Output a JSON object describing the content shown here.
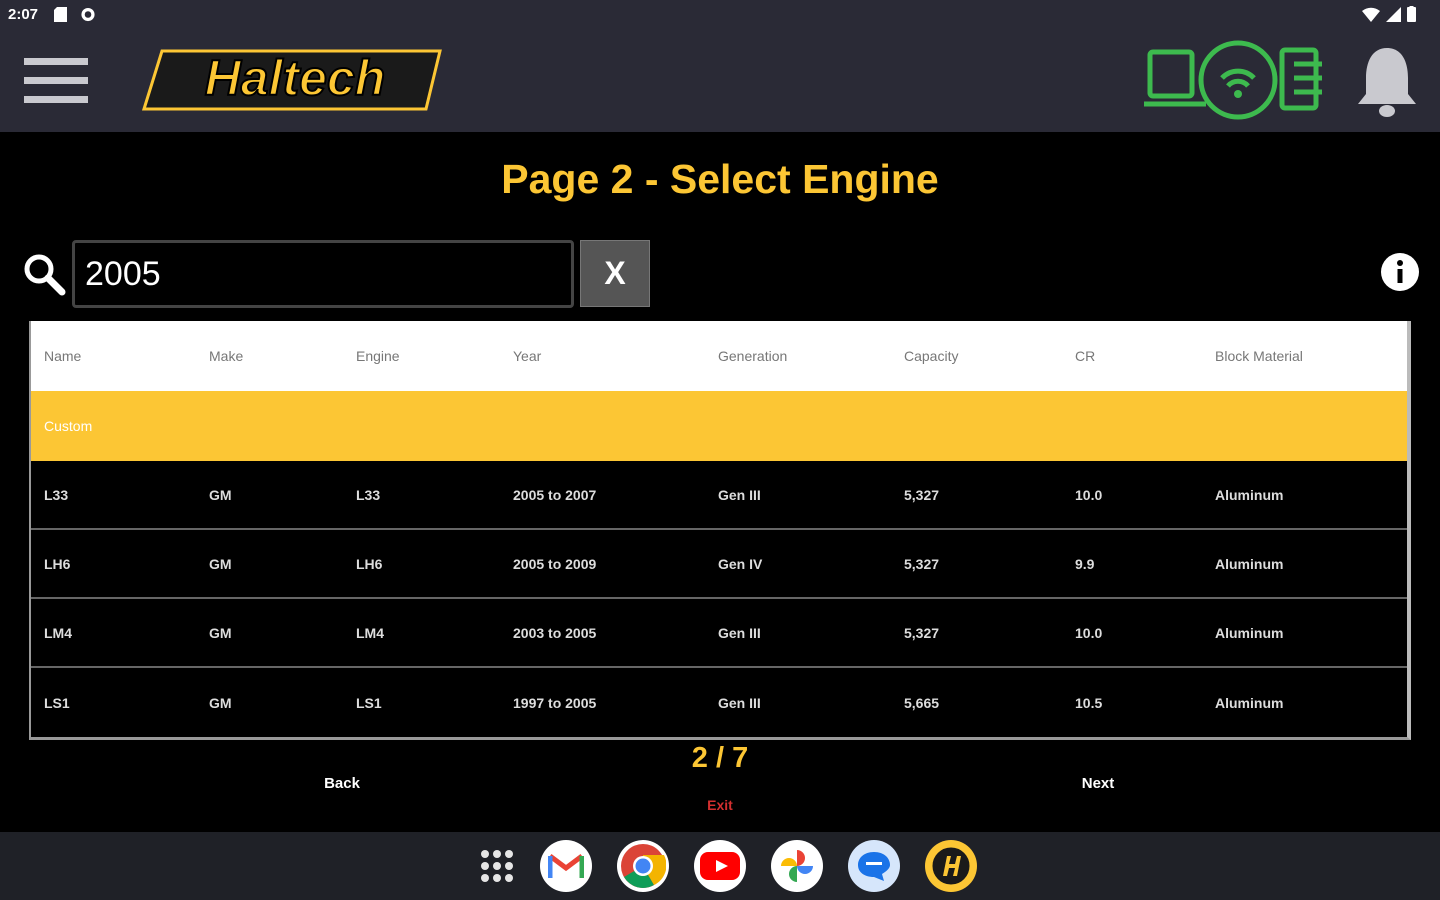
{
  "status_bar": {
    "time": "2:07"
  },
  "header": {
    "logo_text": "Haltech"
  },
  "page": {
    "title": "Page 2 - Select Engine"
  },
  "search": {
    "value": "2005",
    "clear_label": "X"
  },
  "table": {
    "columns": [
      "Name",
      "Make",
      "Engine",
      "Year",
      "Generation",
      "Capacity",
      "CR",
      "Block Material"
    ],
    "custom_label": "Custom",
    "rows": [
      [
        "L33",
        "GM",
        "L33",
        "2005 to 2007",
        "Gen III",
        "5,327",
        "10.0",
        "Aluminum"
      ],
      [
        "LH6",
        "GM",
        "LH6",
        "2005 to 2009",
        "Gen IV",
        "5,327",
        "9.9",
        "Aluminum"
      ],
      [
        "LM4",
        "GM",
        "LM4",
        "2003 to 2005",
        "Gen III",
        "5,327",
        "10.0",
        "Aluminum"
      ],
      [
        "LS1",
        "GM",
        "LS1",
        "1997 to 2005",
        "Gen III",
        "5,665",
        "10.5",
        "Aluminum"
      ]
    ]
  },
  "pager": {
    "indicator": "2 / 7",
    "back_label": "Back",
    "next_label": "Next",
    "exit_label": "Exit"
  },
  "colors": {
    "accent": "#fcc634",
    "header_bg": "#2a2a36",
    "connection": "#3dba4e",
    "exit": "#d32f2f"
  },
  "dock": {
    "apps": [
      "app-grid-icon",
      "gmail-icon",
      "chrome-icon",
      "youtube-icon",
      "photos-icon",
      "messages-icon",
      "haltech-app-icon"
    ]
  }
}
